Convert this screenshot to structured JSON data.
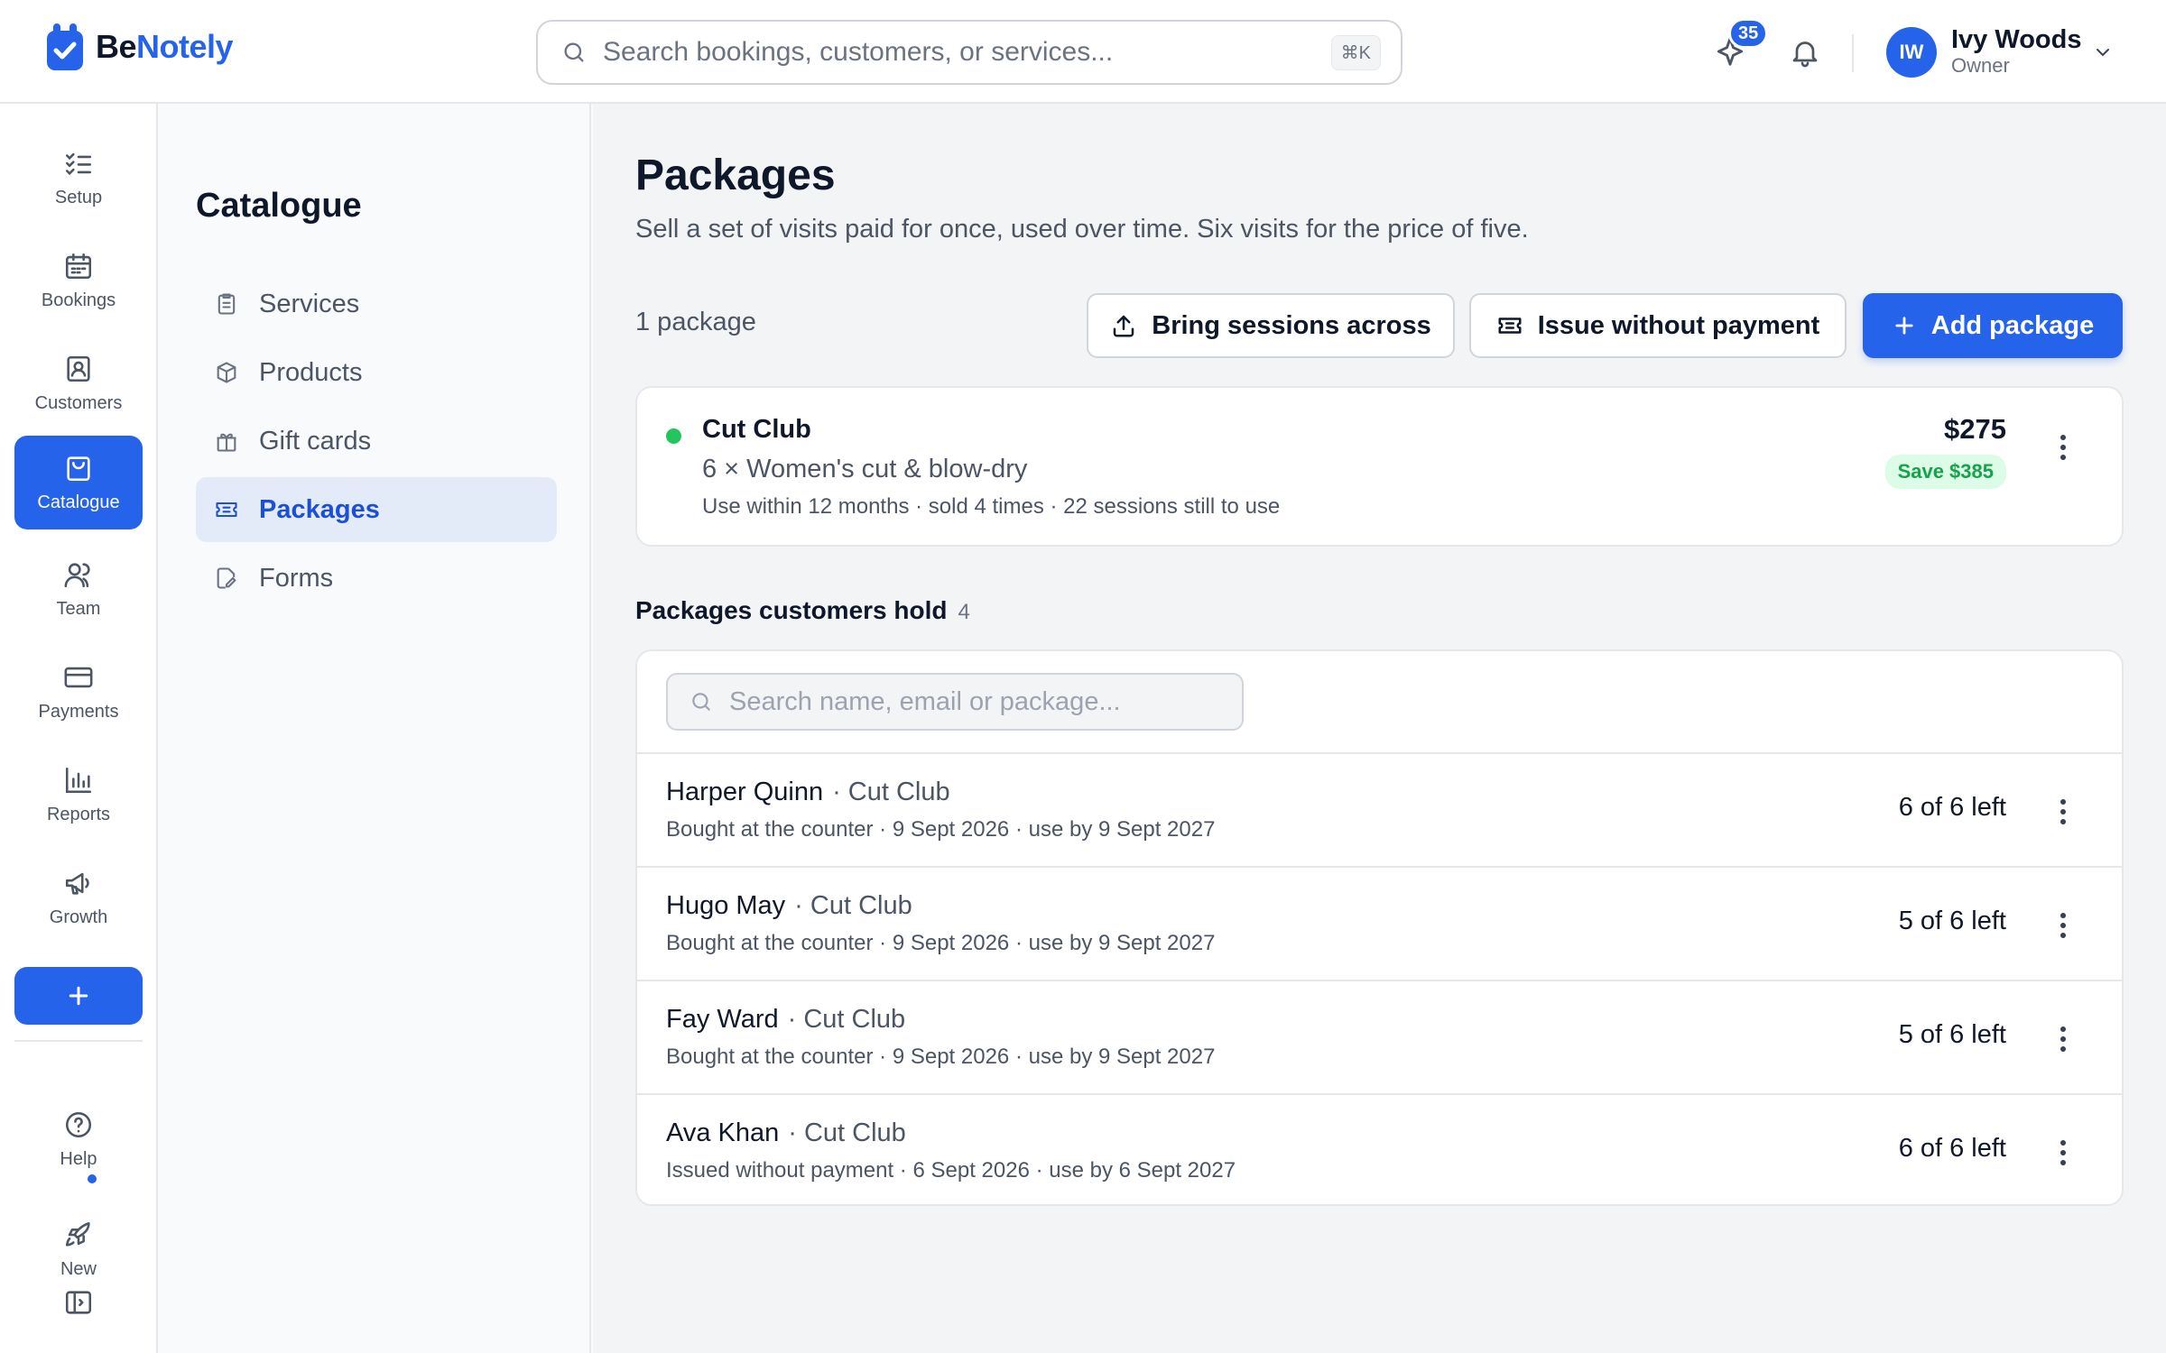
{
  "app": {
    "logo_text_be": "Be",
    "logo_text_notely": "Notely",
    "accent_color": "#2563eb"
  },
  "header": {
    "search_placeholder": "Search bookings, customers, or services...",
    "search_shortcut": "⌘K",
    "notifications_badge": "35",
    "user": {
      "initials": "IW",
      "name": "Ivy Woods",
      "role": "Owner"
    }
  },
  "rail": {
    "items": [
      {
        "label": "Setup",
        "icon": "checklist-icon"
      },
      {
        "label": "Bookings",
        "icon": "calendar-icon"
      },
      {
        "label": "Customers",
        "icon": "contact-card-icon"
      },
      {
        "label": "Catalogue",
        "icon": "shopping-bag-icon",
        "active": true
      },
      {
        "label": "Team",
        "icon": "users-icon"
      },
      {
        "label": "Payments",
        "icon": "credit-card-icon"
      },
      {
        "label": "Reports",
        "icon": "bar-chart-icon"
      },
      {
        "label": "Growth",
        "icon": "megaphone-icon"
      }
    ],
    "bottom": [
      {
        "label": "Help",
        "icon": "help-circle-icon"
      },
      {
        "label": "New",
        "icon": "rocket-icon"
      }
    ]
  },
  "catalogue": {
    "title": "Catalogue",
    "items": [
      {
        "label": "Services",
        "icon": "clipboard-icon"
      },
      {
        "label": "Products",
        "icon": "box-icon"
      },
      {
        "label": "Gift cards",
        "icon": "gift-icon"
      },
      {
        "label": "Packages",
        "icon": "ticket-icon",
        "active": true
      },
      {
        "label": "Forms",
        "icon": "form-edit-icon"
      }
    ]
  },
  "main": {
    "title": "Packages",
    "subtitle": "Sell a set of visits paid for once, used over time. Six visits for the price of five.",
    "count": "1 package",
    "buttons": {
      "bring_sessions": "Bring sessions across",
      "issue_without_payment": "Issue without payment",
      "add_package": "Add package"
    },
    "package": {
      "name": "Cut Club",
      "description": "6 × Women's cut & blow-dry",
      "meta": "Use within 12 months · sold 4 times · 22 sessions still to use",
      "price": "$275",
      "save": "Save $385",
      "status_color": "#22c55e"
    },
    "holders_section": {
      "title": "Packages customers hold",
      "count": "4",
      "search_placeholder": "Search name, email or package...",
      "rows": [
        {
          "name": "Harper Quinn",
          "package": "· Cut Club",
          "detail": "Bought at the counter · 9 Sept 2026 · use by 9 Sept 2027",
          "remaining": "6 of 6 left"
        },
        {
          "name": "Hugo May",
          "package": "· Cut Club",
          "detail": "Bought at the counter · 9 Sept 2026 · use by 9 Sept 2027",
          "remaining": "5 of 6 left"
        },
        {
          "name": "Fay Ward",
          "package": "· Cut Club",
          "detail": "Bought at the counter · 9 Sept 2026 · use by 9 Sept 2027",
          "remaining": "5 of 6 left"
        },
        {
          "name": "Ava Khan",
          "package": "· Cut Club",
          "detail": "Issued without payment · 6 Sept 2026 · use by 6 Sept 2027",
          "remaining": "6 of 6 left"
        }
      ]
    }
  }
}
